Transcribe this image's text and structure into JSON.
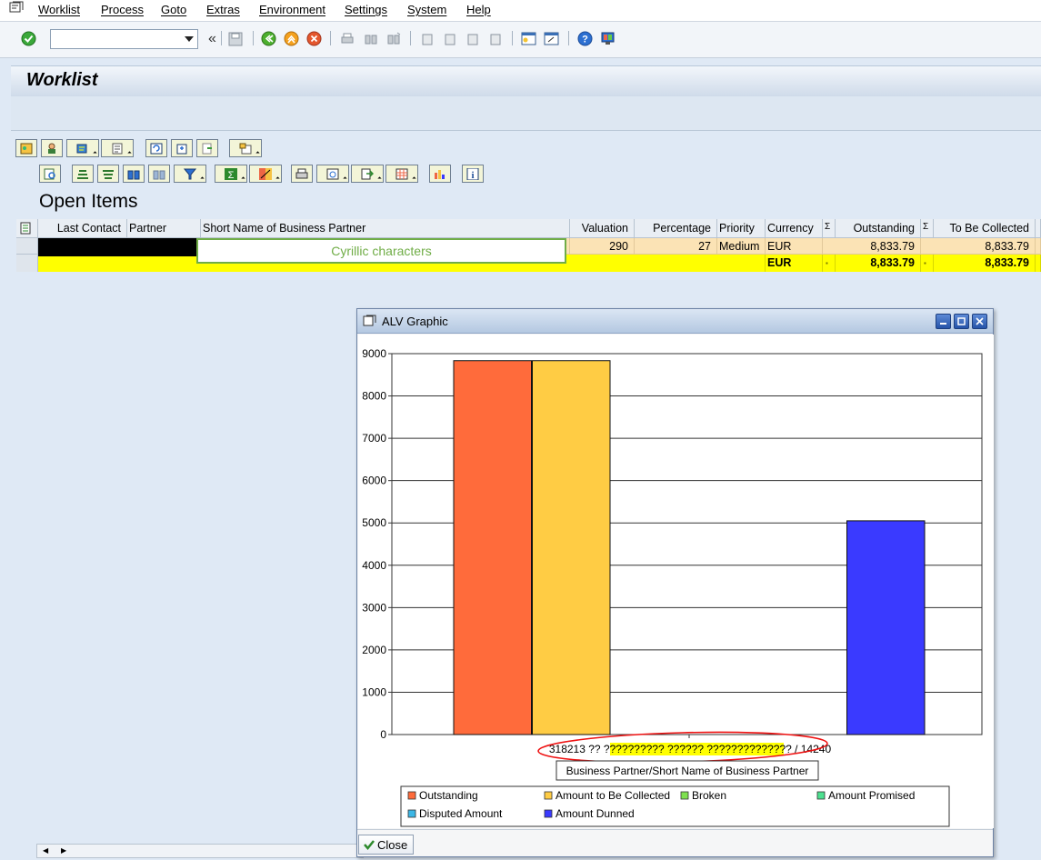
{
  "menu": {
    "items": [
      "Worklist",
      "Process",
      "Goto",
      "Extras",
      "Environment",
      "Settings",
      "System",
      "Help"
    ]
  },
  "toolbar": {
    "back_glyph": "«"
  },
  "screen": {
    "title": "Worklist",
    "section_title": "Open Items"
  },
  "grid": {
    "columns": [
      "Last Contact",
      "Partner",
      "Short Name of Business Partner",
      "Valuation",
      "Percentage",
      "Priority",
      "Currency",
      "Σ",
      "Outstanding",
      "Σ",
      "To Be Collected"
    ],
    "row": {
      "valuation": "290",
      "percentage": "27",
      "priority": "Medium",
      "currency": "EUR",
      "outstanding": "8,833.79",
      "to_be_collected": "8,833.79"
    },
    "total": {
      "currency": "EUR",
      "dot1": "▪",
      "outstanding": "8,833.79",
      "dot2": "▪",
      "to_be_collected": "8,833.79"
    },
    "annotation": "Cyrillic characters"
  },
  "popup": {
    "title": "ALV Graphic",
    "close_label": "Close"
  },
  "chart_data": {
    "type": "bar",
    "categories": [
      "318213 ?? ?????????? ?????? ?????????????? / 14240"
    ],
    "xlabel": "Business Partner/Short Name of Business Partner",
    "ylim": [
      0,
      9000
    ],
    "yticks": [
      0,
      1000,
      2000,
      3000,
      4000,
      5000,
      6000,
      7000,
      8000,
      9000
    ],
    "grid": true,
    "legend_position": "bottom",
    "series": [
      {
        "name": "Outstanding",
        "values": [
          8833.79
        ],
        "color": "#ff6b3b"
      },
      {
        "name": "Amount to Be Collected",
        "values": [
          8833.79
        ],
        "color": "#ffcc44"
      },
      {
        "name": "Broken",
        "values": [
          0
        ],
        "color": "#7ee04f"
      },
      {
        "name": "Amount Promised",
        "values": [
          0
        ],
        "color": "#4de08f"
      },
      {
        "name": "Disputed Amount",
        "values": [
          0
        ],
        "color": "#3cb7e6"
      },
      {
        "name": "Amount Dunned",
        "values": [
          5050
        ],
        "color": "#3a3aff"
      }
    ]
  }
}
